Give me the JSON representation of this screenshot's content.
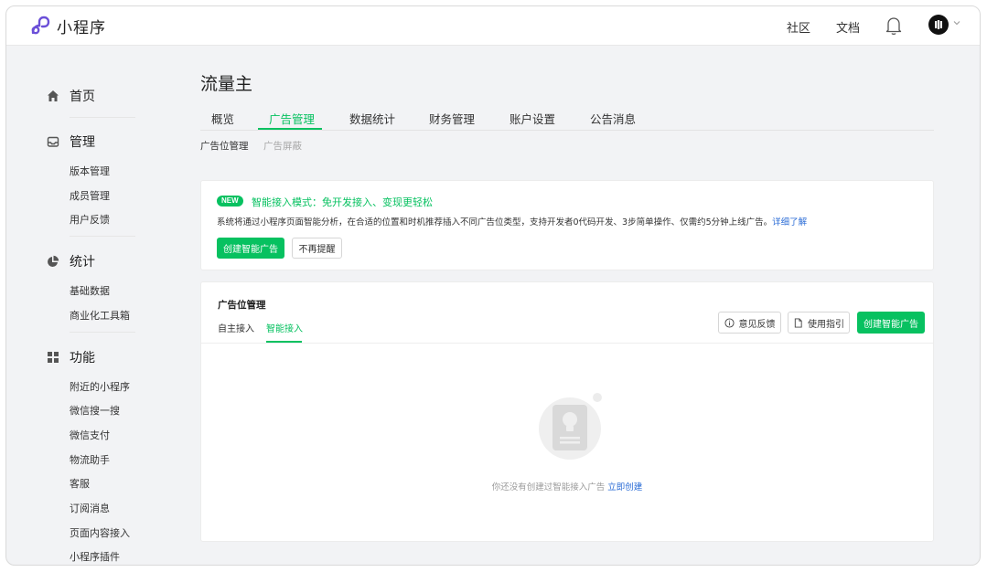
{
  "app": {
    "title": "小程序"
  },
  "topnav": {
    "links": [
      "社区",
      "文档"
    ],
    "avatar_letter": "D"
  },
  "sidebar": {
    "groups": [
      {
        "title": "首页",
        "icon": "home-icon",
        "items": []
      },
      {
        "title": "管理",
        "icon": "inbox-icon",
        "items": [
          "版本管理",
          "成员管理",
          "用户反馈"
        ]
      },
      {
        "title": "统计",
        "icon": "pie-chart-icon",
        "items": [
          "基础数据",
          "商业化工具箱"
        ]
      },
      {
        "title": "功能",
        "icon": "grid-icon",
        "items": [
          "附近的小程序",
          "微信搜一搜",
          "微信支付",
          "物流助手",
          "客服",
          "订阅消息",
          "页面内容接入",
          "小程序插件"
        ]
      }
    ]
  },
  "page": {
    "title": "流量主",
    "tabs": [
      "概览",
      "广告管理",
      "数据统计",
      "财务管理",
      "账户设置",
      "公告消息"
    ],
    "active_tab": "广告管理",
    "subtabs": [
      "广告位管理",
      "广告屏蔽"
    ],
    "active_subtab": "广告位管理"
  },
  "banner": {
    "badge": "NEW",
    "title": "智能接入模式：免开发接入、变现更轻松",
    "description": "系统将通过小程序页面智能分析，在合适的位置和时机推荐插入不同广告位类型，支持开发者0代码开发、3步简单操作、仅需约5分钟上线广告。",
    "link": "详细了解",
    "primary_button": "创建智能广告",
    "secondary_button": "不再提醒"
  },
  "ad_card": {
    "title": "广告位管理",
    "tabs": [
      "自主接入",
      "智能接入"
    ],
    "active_tab": "智能接入",
    "feedback_button": "意见反馈",
    "guide_button": "使用指引",
    "create_button": "创建智能广告",
    "empty_text": "你还没有创建过智能接入广告",
    "empty_link": "立即创建"
  },
  "colors": {
    "accent": "#07c160",
    "link": "#2b6cd6",
    "brand_logo": "#6b4fd8"
  }
}
